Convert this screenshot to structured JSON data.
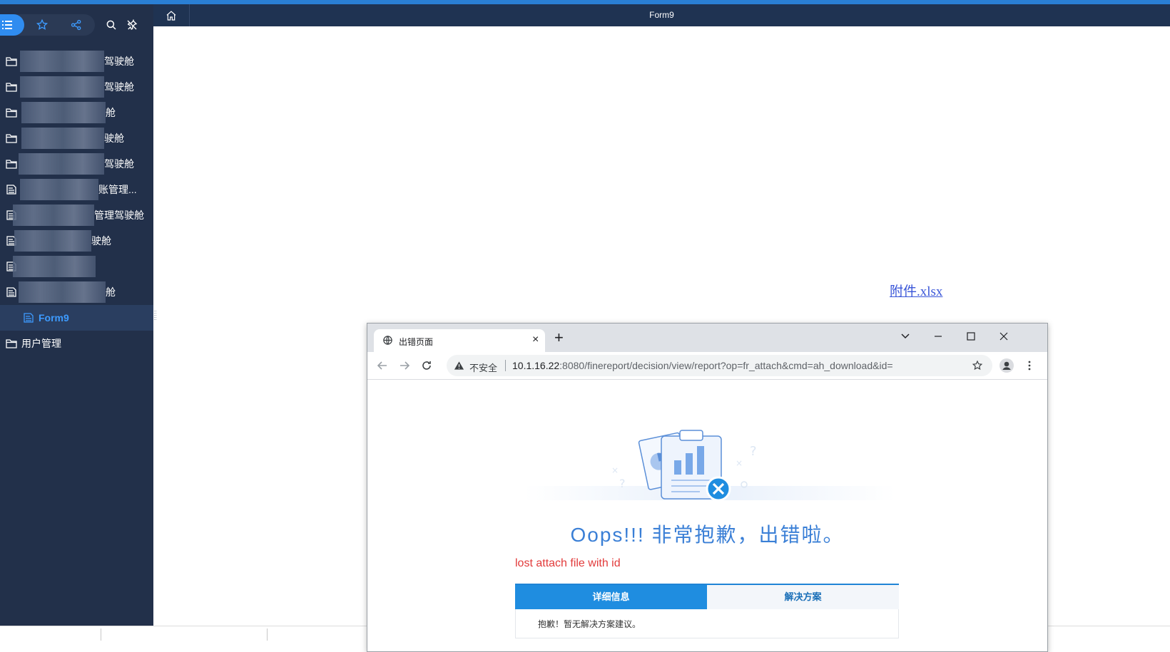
{
  "sidebar": {
    "items": [
      {
        "label": "驾驶舱"
      },
      {
        "label": "驾驶舱"
      },
      {
        "label": "舱"
      },
      {
        "label": "驶舱"
      },
      {
        "label": "驾驶舱"
      },
      {
        "label": "账管理..."
      },
      {
        "label": "管理驾驶舱"
      },
      {
        "label": "驶舱"
      },
      {
        "label": ""
      },
      {
        "label": "舱"
      },
      {
        "label": "Form9"
      },
      {
        "label": "用户管理"
      }
    ]
  },
  "header": {
    "title": "Form9"
  },
  "main": {
    "attachment_link": "附件.xlsx"
  },
  "browser": {
    "tab_title": "出错页面",
    "tab_close": "×",
    "new_tab": "+",
    "security_label": "不安全",
    "url_host": "10.1.16.22",
    "url_rest": ":8080/finereport/decision/view/report?op=fr_attach&cmd=ah_download&id="
  },
  "error_page": {
    "heading": "Oops!!! 非常抱歉，出错啦。",
    "message": "lost attach file with id",
    "tabs": [
      {
        "label": "详细信息",
        "active": true
      },
      {
        "label": "解决方案",
        "active": false
      }
    ],
    "detail_text": "抱歉！暂无解决方案建议。"
  },
  "colors": {
    "sidebar_bg": "#22304a",
    "accent": "#2f8cf0",
    "topbar_bg": "#1f3352",
    "error_red": "#e23b3b",
    "heading_blue": "#3a7fd6"
  }
}
